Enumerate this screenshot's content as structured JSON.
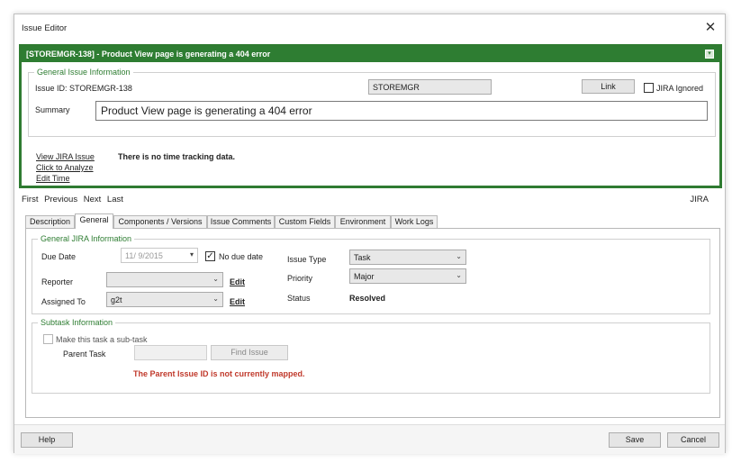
{
  "window": {
    "title": "Issue Editor",
    "close_glyph": "✕"
  },
  "issue_header": {
    "title": "[STOREMGR-138] - Product View page is generating a 404 error",
    "collapse_glyph": "▾"
  },
  "general_issue_info": {
    "legend": "General Issue Information",
    "issue_id_label": "Issue ID: STOREMGR-138",
    "project_value": "STOREMGR",
    "link_button": "Link",
    "jira_ignored_label": "JIRA Ignored",
    "summary_label": "Summary",
    "summary_value": "Product View page is generating a 404 error"
  },
  "links": {
    "view_jira": "View JIRA Issue",
    "click_analyze": "Click to Analyze",
    "edit_time": "Edit Time"
  },
  "time_tracking_text": "There is no time tracking data.",
  "nav": {
    "first": "First",
    "previous": "Previous",
    "next": "Next",
    "last": "Last",
    "right_label": "JIRA"
  },
  "tabs": [
    "Description",
    "General",
    "Components / Versions",
    "Issue Comments",
    "Custom Fields",
    "Environment",
    "Work Logs"
  ],
  "active_tab": "General",
  "general_jira": {
    "legend": "General JIRA Information",
    "due_date_label": "Due Date",
    "due_date_value": "11/  9/2015",
    "no_due_date_label": "No due date",
    "no_due_date_checked": true,
    "reporter_label": "Reporter",
    "reporter_value": "",
    "assigned_label": "Assigned To",
    "assigned_value": "g2t",
    "edit_label": "Edit",
    "issue_type_label": "Issue Type",
    "issue_type_value": "Task",
    "priority_label": "Priority",
    "priority_value": "Major",
    "status_label": "Status",
    "status_value": "Resolved"
  },
  "subtask": {
    "legend": "Subtask Information",
    "make_subtask_label": "Make this task a sub-task",
    "parent_task_label": "Parent Task",
    "parent_task_value": "",
    "find_issue_button": "Find Issue",
    "warning": "The Parent Issue ID is not currently mapped."
  },
  "footer": {
    "help": "Help",
    "save": "Save",
    "cancel": "Cancel"
  },
  "colors": {
    "accent_green": "#2e7d32",
    "warning_red": "#c0392b"
  }
}
